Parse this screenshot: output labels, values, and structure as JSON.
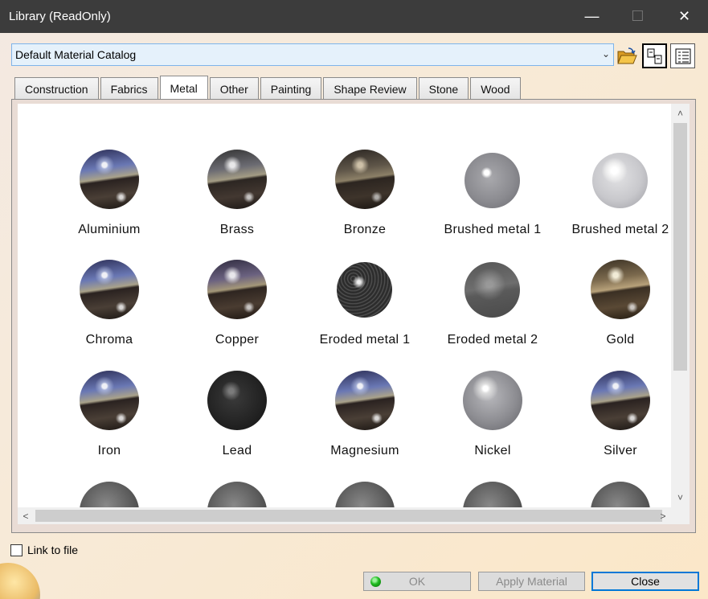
{
  "window": {
    "title": "Library (ReadOnly)",
    "min_glyph": "—",
    "max_glyph": "☐",
    "close_glyph": "✕"
  },
  "catalog": {
    "selected": "Default Material Catalog",
    "arrow": "⌄"
  },
  "tabs": [
    {
      "label": "Construction"
    },
    {
      "label": "Fabrics"
    },
    {
      "label": "Metal",
      "active": true
    },
    {
      "label": "Other"
    },
    {
      "label": "Painting"
    },
    {
      "label": "Shape Review"
    },
    {
      "label": "Stone"
    },
    {
      "label": "Wood"
    }
  ],
  "materials": [
    {
      "label": "Aluminium",
      "icon": "env-blue"
    },
    {
      "label": "Brass",
      "icon": "env-grey"
    },
    {
      "label": "Bronze",
      "icon": "env-bronze"
    },
    {
      "label": "Brushed metal 1",
      "icon": "brushed1"
    },
    {
      "label": "Brushed metal 2",
      "icon": "brushed2"
    },
    {
      "label": "Chroma",
      "icon": "env-blue"
    },
    {
      "label": "Copper",
      "icon": "env-copper"
    },
    {
      "label": "Eroded metal 1",
      "icon": "eroded1"
    },
    {
      "label": "Eroded metal 2",
      "icon": "eroded2"
    },
    {
      "label": "Gold",
      "icon": "env-gold"
    },
    {
      "label": "Iron",
      "icon": "env-blue"
    },
    {
      "label": "Lead",
      "icon": "lead"
    },
    {
      "label": "Magnesium",
      "icon": "env-blue"
    },
    {
      "label": "Nickel",
      "icon": "nickel"
    },
    {
      "label": "Silver",
      "icon": "env-blue"
    }
  ],
  "scroll": {
    "up": "˄",
    "down": "˅",
    "left": "<",
    "right": ">"
  },
  "options": {
    "link_to_file": "Link to file"
  },
  "buttons": {
    "ok": "OK",
    "apply": "Apply Material",
    "close": "Close"
  }
}
